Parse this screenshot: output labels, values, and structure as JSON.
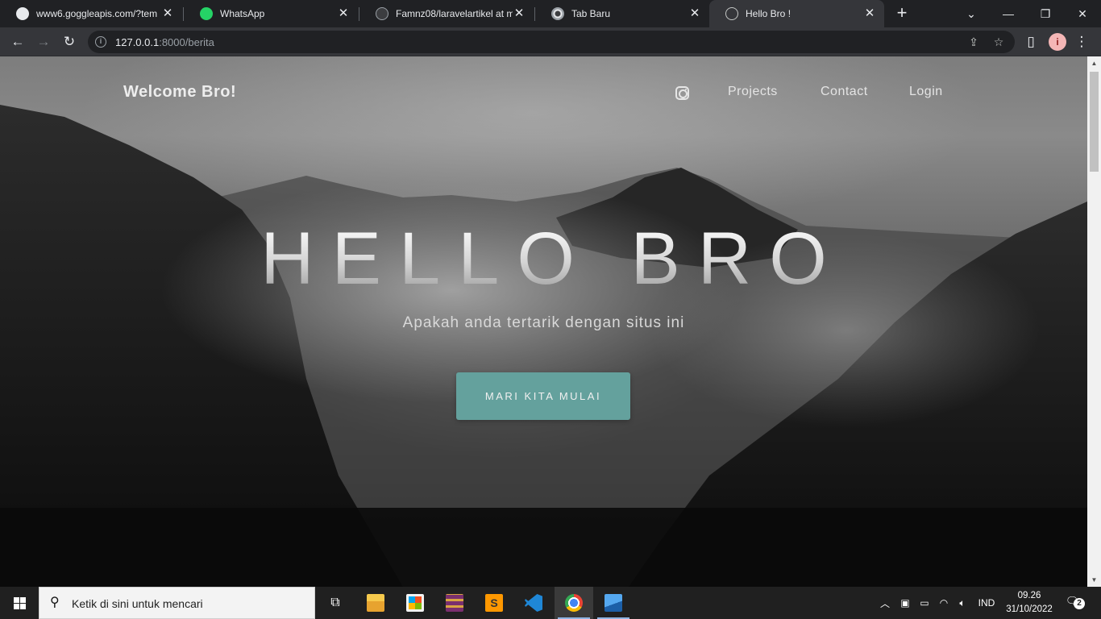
{
  "browser": {
    "tabs": [
      {
        "title": "www6.goggleapis.com/?tem",
        "icon": "globe-icon"
      },
      {
        "title": "WhatsApp",
        "icon": "whatsapp-icon"
      },
      {
        "title": "Famnz08/laravelartikel at ma",
        "icon": "github-icon"
      },
      {
        "title": "Tab Baru",
        "icon": "chrome-icon"
      },
      {
        "title": "Hello Bro !",
        "icon": "globe-icon",
        "active": true
      }
    ],
    "url_host": "127.0.0.1",
    "url_rest": ":8000/berita"
  },
  "page": {
    "brand": "Welcome Bro!",
    "nav": {
      "projects": "Projects",
      "contact": "Contact",
      "login": "Login"
    },
    "hero_title": "HELLO BRO",
    "hero_subtitle": "Apakah anda tertarik dengan situs ini",
    "cta_label": "MARI KITA MULAI",
    "accent_color": "#64a19d"
  },
  "taskbar": {
    "search_placeholder": "Ketik di sini untuk mencari",
    "language": "IND",
    "time": "09.26",
    "date": "31/10/2022",
    "notification_count": "2"
  }
}
